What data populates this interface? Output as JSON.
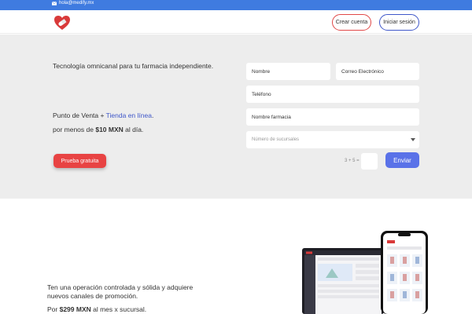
{
  "topbar": {
    "email": "hola@medify.mx",
    "email_icon": "envelope-icon"
  },
  "header": {
    "logo": "heart-pill-logo",
    "crear_cuenta": "Crear cuenta",
    "iniciar_sesion": "Iniciar sesión"
  },
  "hero": {
    "title": "Tecnología omnicanal para tu farmacia independiente.",
    "line1_prefix": "Punto de Venta + ",
    "line1_link": "Tienda en línea",
    "line1_suffix": ".",
    "line2_prefix": "por menos de ",
    "line2_price": "$10 MXN",
    "line2_suffix": " al día.",
    "cta": "Prueba gratuita"
  },
  "form": {
    "nombre": "Nombre",
    "correo": "Correo Electrónico",
    "telefono": "Teléfono",
    "farmacia": "Nombre farmacia",
    "sucursales_placeholder": "Número de sucursales",
    "captcha": "3 + 5 =",
    "captcha_answer": "",
    "submit": "Enviar"
  },
  "section2": {
    "text1": "Ten una operación controlada y sólida y adquiere nuevos canales de promoción.",
    "text2_prefix": "Por ",
    "text2_price": "$299 MXN",
    "text2_suffix": " al mes x sucursal."
  },
  "colors": {
    "topbar": "#3f7be0",
    "hero_bg": "#ededed",
    "accent_red": "#e84343",
    "accent_blue": "#5a72e8",
    "link_blue": "#3f57c9"
  }
}
